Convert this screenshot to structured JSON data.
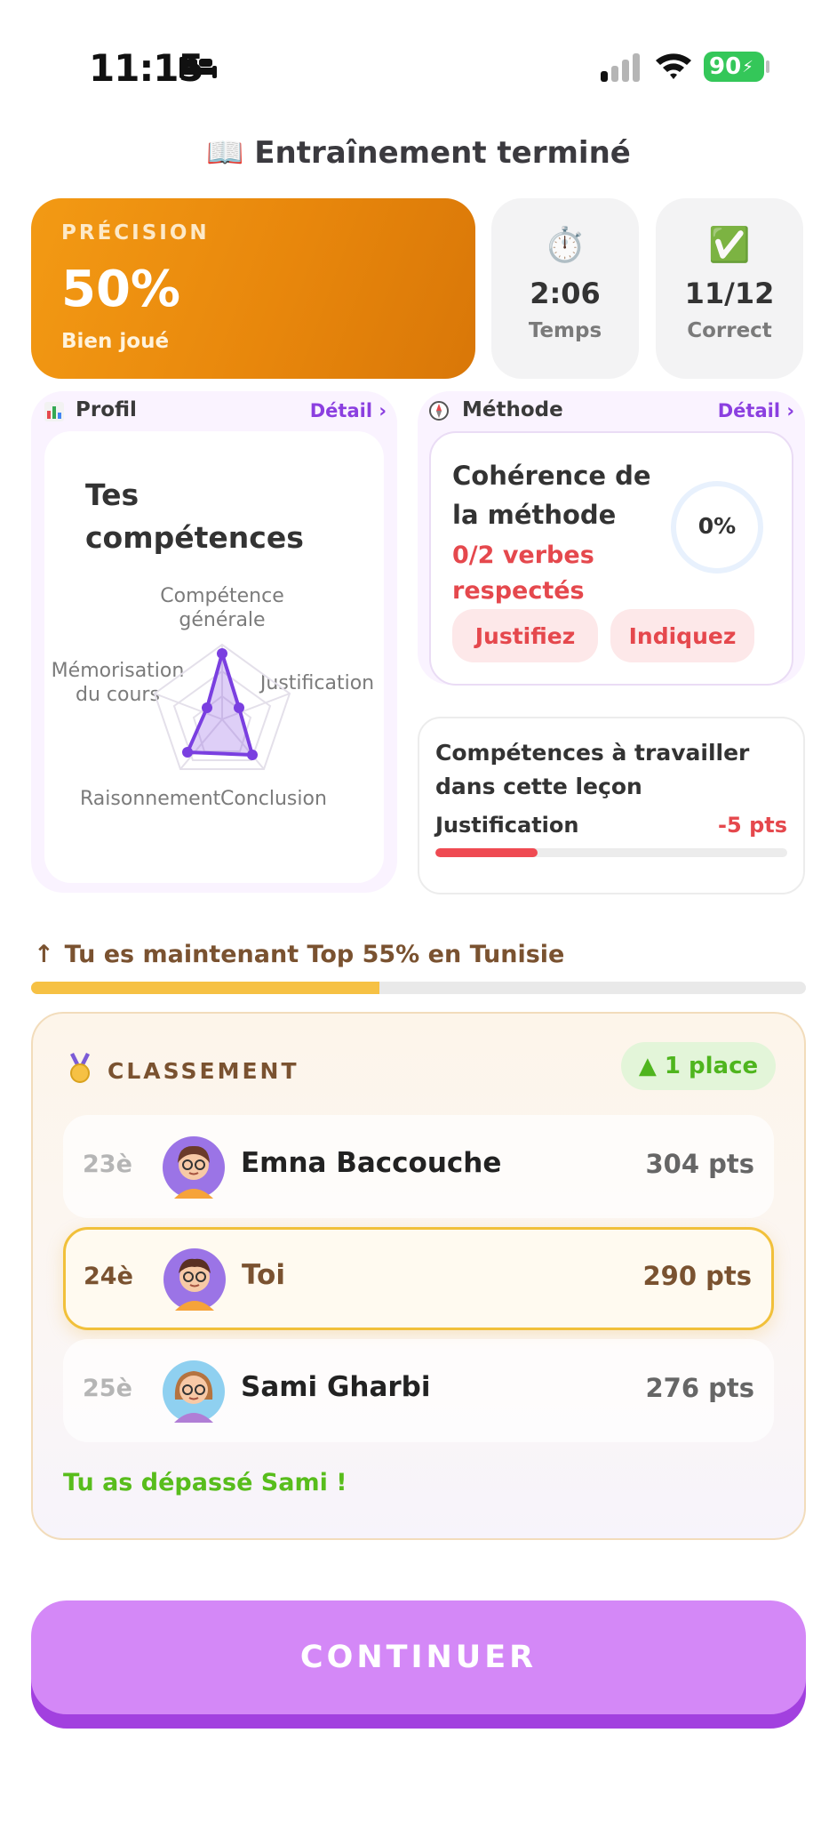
{
  "status_bar": {
    "time": "11:15",
    "battery": "90"
  },
  "title": "📖 Entraînement terminé",
  "precision": {
    "label": "PRÉCISION",
    "value": "50%",
    "sub": "Bien joué"
  },
  "stats": [
    {
      "icon": "⏱️",
      "value": "2:06",
      "label": "Temps"
    },
    {
      "icon": "✅",
      "value": "11/12",
      "label": "Correct"
    }
  ],
  "profil": {
    "header": "Profil",
    "detail": "Détail ›",
    "skills_title_1": "Tes",
    "skills_title_2": "compétences",
    "radar_labels": {
      "top_1": "Compétence",
      "top_2": "générale",
      "left_1": "Mémorisation",
      "left_2": "du cours",
      "right": "Justification",
      "bottom_left": "Raisonnement",
      "bottom_right": "Conclusion"
    },
    "radar_color": "#7a3fe0"
  },
  "methode": {
    "header": "Méthode",
    "detail": "Détail ›",
    "coherence_1": "Cohérence de",
    "coherence_2": "la méthode",
    "verbs_1": "0/2 verbes",
    "verbs_2": "respectés",
    "percent": "0%",
    "chips": [
      "Justifiez",
      "Indiquez"
    ]
  },
  "competences": {
    "title_1": "Compétences à travailler",
    "title_2": "dans cette leçon",
    "skill": "Justification",
    "points": "-5 pts",
    "progress": 0.29
  },
  "top": {
    "text": "Tu es maintenant Top 55% en Tunisie",
    "arrow": "↑",
    "progress": 0.45
  },
  "ranking": {
    "title": "CLASSEMENT",
    "badge": "▲ 1 place",
    "rows": [
      {
        "pos": "23è",
        "name": "Emna Baccouche",
        "pts": "304 pts"
      },
      {
        "pos": "24è",
        "name": "Toi",
        "pts": "290 pts"
      },
      {
        "pos": "25è",
        "name": "Sami Gharbi",
        "pts": "276 pts"
      }
    ],
    "passed": "Tu as dépassé Sami !"
  },
  "continue_label": "CONTINUER",
  "colors": {
    "accent": "#d488f7",
    "precision": "#f39a14",
    "error": "#e5484d",
    "success": "#58bd1c"
  }
}
